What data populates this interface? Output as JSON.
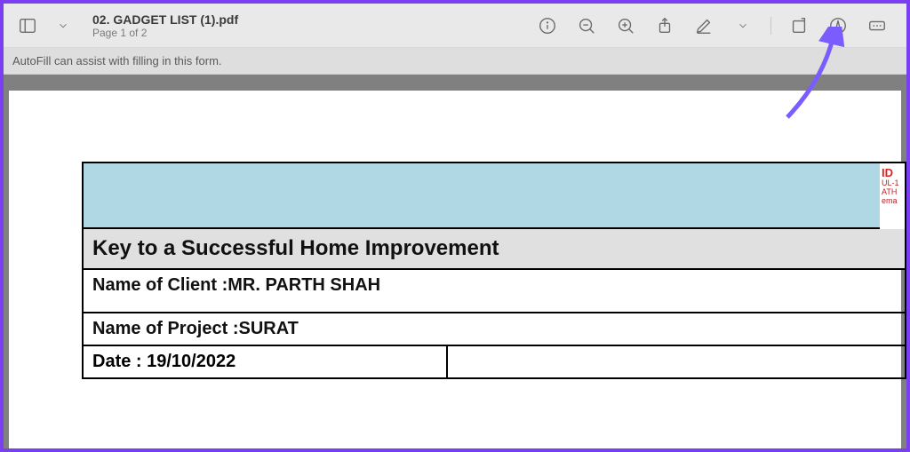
{
  "toolbar": {
    "doc_title": "02. GADGET LIST (1).pdf",
    "page_indicator": "Page 1 of 2"
  },
  "autofill": {
    "message": "AutoFill can assist with filling in this form."
  },
  "document": {
    "section_title": "Key to a Successful Home Improvement",
    "client_label": "Name of Client : ",
    "client_value": "MR. PARTH SHAH",
    "project_label": "Name of Project : ",
    "project_value": "SURAT",
    "date_label": "Date : ",
    "date_value": "19/10/2022",
    "logo": {
      "line1": "ID",
      "line2": "UL-1",
      "line3": "ATH",
      "line4": "ema"
    }
  }
}
